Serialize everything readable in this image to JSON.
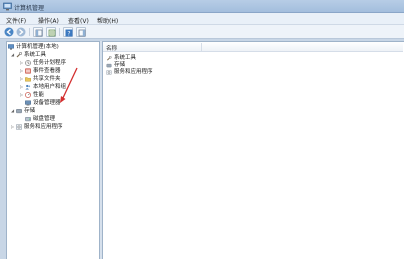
{
  "window": {
    "title": "计算机管理"
  },
  "menu": [
    {
      "label": "文件(F)"
    },
    {
      "label": "操作(A)"
    },
    {
      "label": "查看(V)"
    },
    {
      "label": "帮助(H)"
    }
  ],
  "toolbar": {
    "buttons": [
      "back-icon",
      "forward-icon",
      "show-hide-tree-icon",
      "properties-icon",
      "help-icon",
      "action-pane-icon"
    ]
  },
  "tree": {
    "root": "计算机管理(本地)",
    "system_tools": "系统工具",
    "task_scheduler": "任务计划程序",
    "event_viewer": "事件查看器",
    "shared_folders": "共享文件夹",
    "local_users": "本地用户和组",
    "performance": "性能",
    "device_manager": "设备管理器",
    "storage": "存储",
    "disk_management": "磁盘管理",
    "services_apps": "服务和应用程序"
  },
  "list": {
    "column_name": "名称",
    "items": [
      "系统工具",
      "存储",
      "服务和应用程序"
    ]
  },
  "colors": {
    "accent": "#a3bedd",
    "annotation_arrow": "#d32f2f"
  }
}
